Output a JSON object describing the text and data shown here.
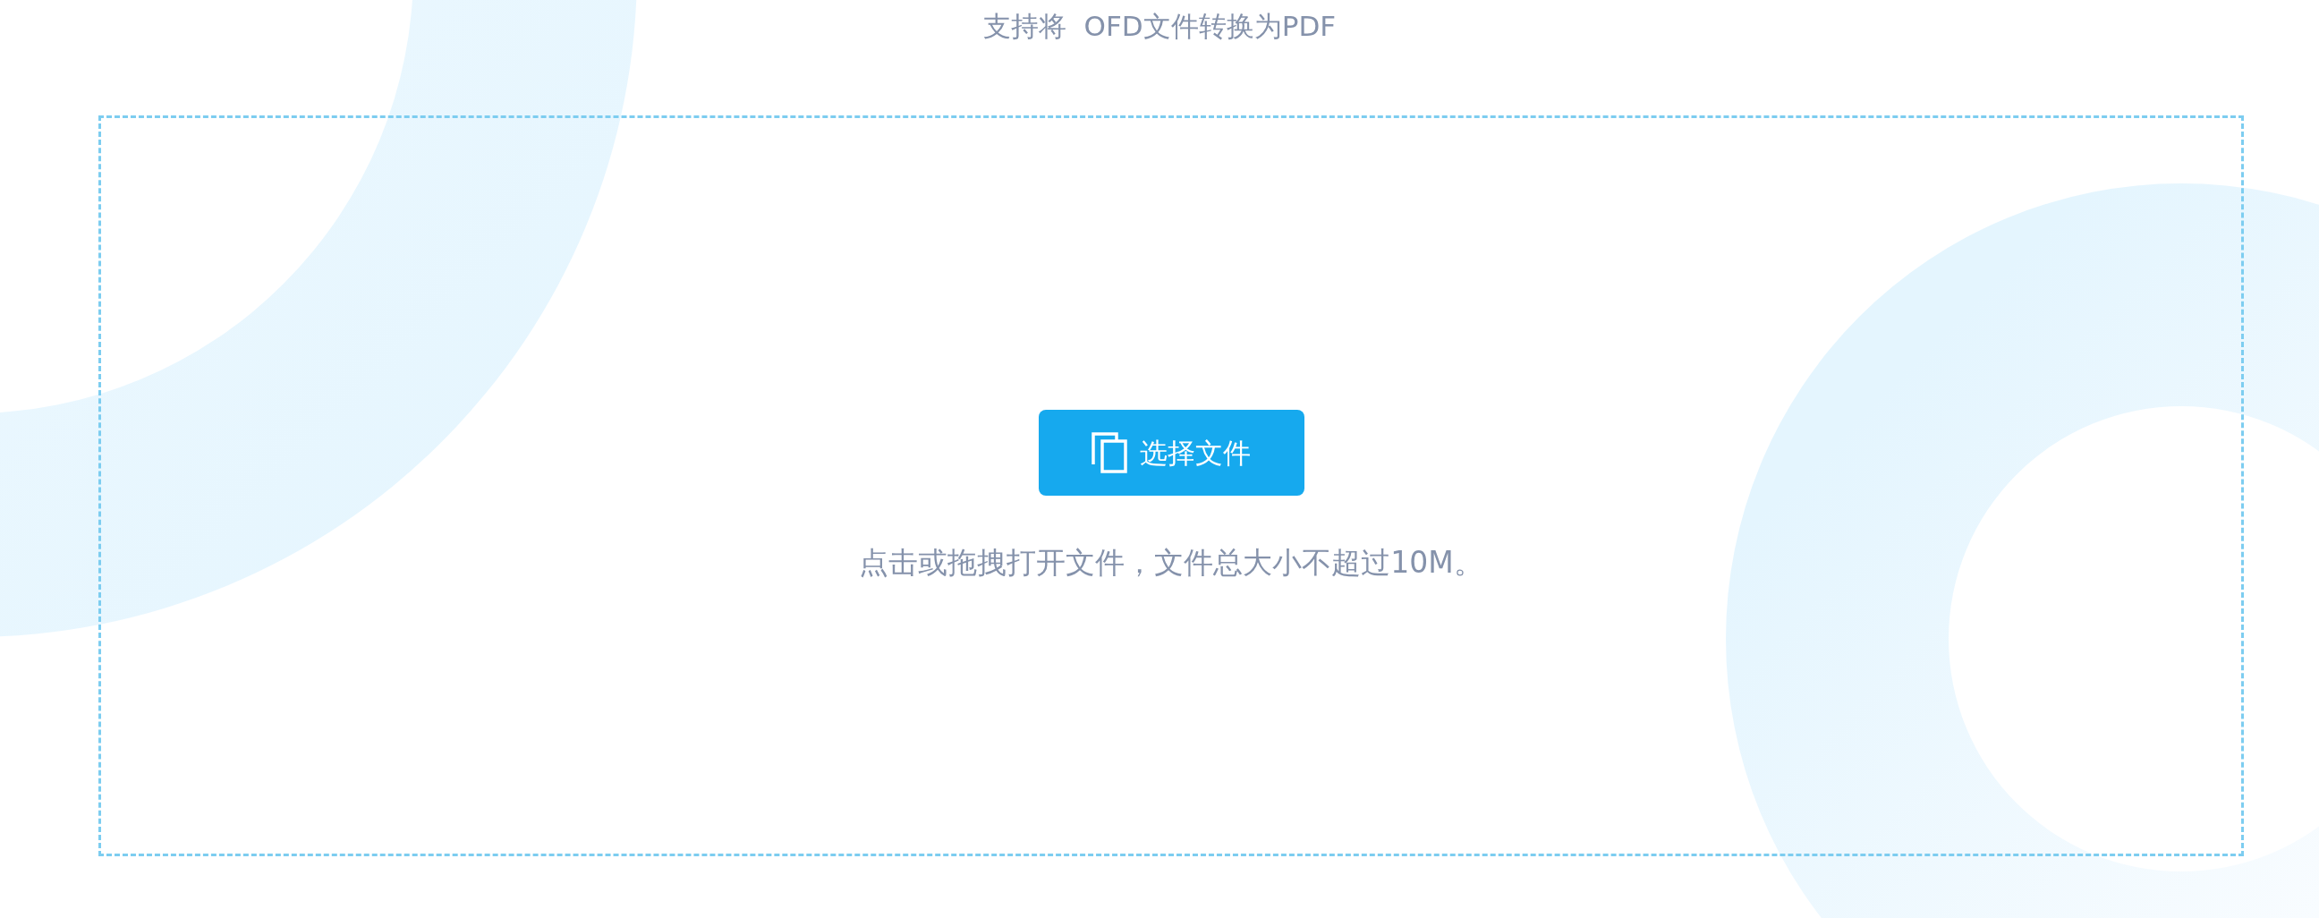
{
  "subtitle": "支持将  OFD文件转换为PDF",
  "upload": {
    "button": "选择文件",
    "hint": "点击或拖拽打开文件，文件总大小不超过10M。"
  }
}
